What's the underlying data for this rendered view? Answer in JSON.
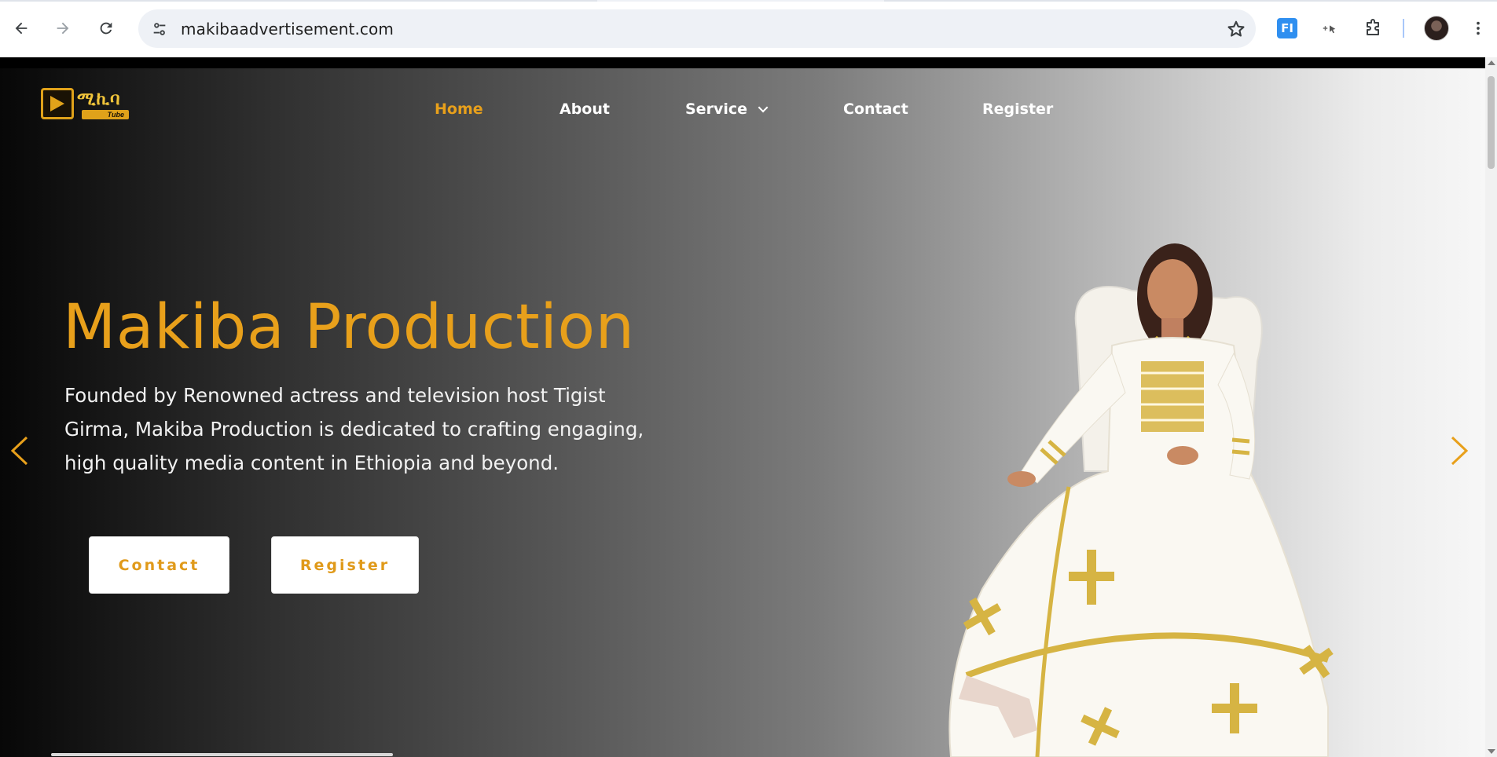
{
  "browser": {
    "url": "makibaadvertisement.com",
    "icons": {
      "back": "arrow-left-icon",
      "forward": "arrow-right-icon",
      "reload": "reload-icon",
      "site_info": "tune-icon",
      "bookmark": "star-icon",
      "extension_fi": "fi-extension-icon",
      "extension_cursor": "cursor-extension-icon",
      "extensions": "puzzle-icon",
      "profile": "profile-avatar",
      "menu": "more-vert-icon"
    },
    "extension_fi_label": "FI"
  },
  "site": {
    "logo": {
      "mark": "logo-mark",
      "word": "ሚኪባ",
      "sub": "Tube"
    },
    "nav": [
      {
        "label": "Home",
        "active": true
      },
      {
        "label": "About",
        "active": false
      },
      {
        "label": "Service",
        "active": false,
        "has_dropdown": true
      },
      {
        "label": "Contact",
        "active": false
      },
      {
        "label": "Register",
        "active": false
      }
    ],
    "hero": {
      "title": "Makiba Production",
      "description": "Founded by Renowned actress and television host Tigist Girma, Makiba Production is dedicated to crafting engaging, high quality media content in Ethiopia and beyond.",
      "buttons": {
        "contact": "Contact",
        "register": "Register"
      }
    },
    "colors": {
      "accent": "#e8a01b",
      "nav_text": "#ffffff",
      "button_bg": "#ffffff",
      "description_text": "#f2f2f2"
    }
  }
}
